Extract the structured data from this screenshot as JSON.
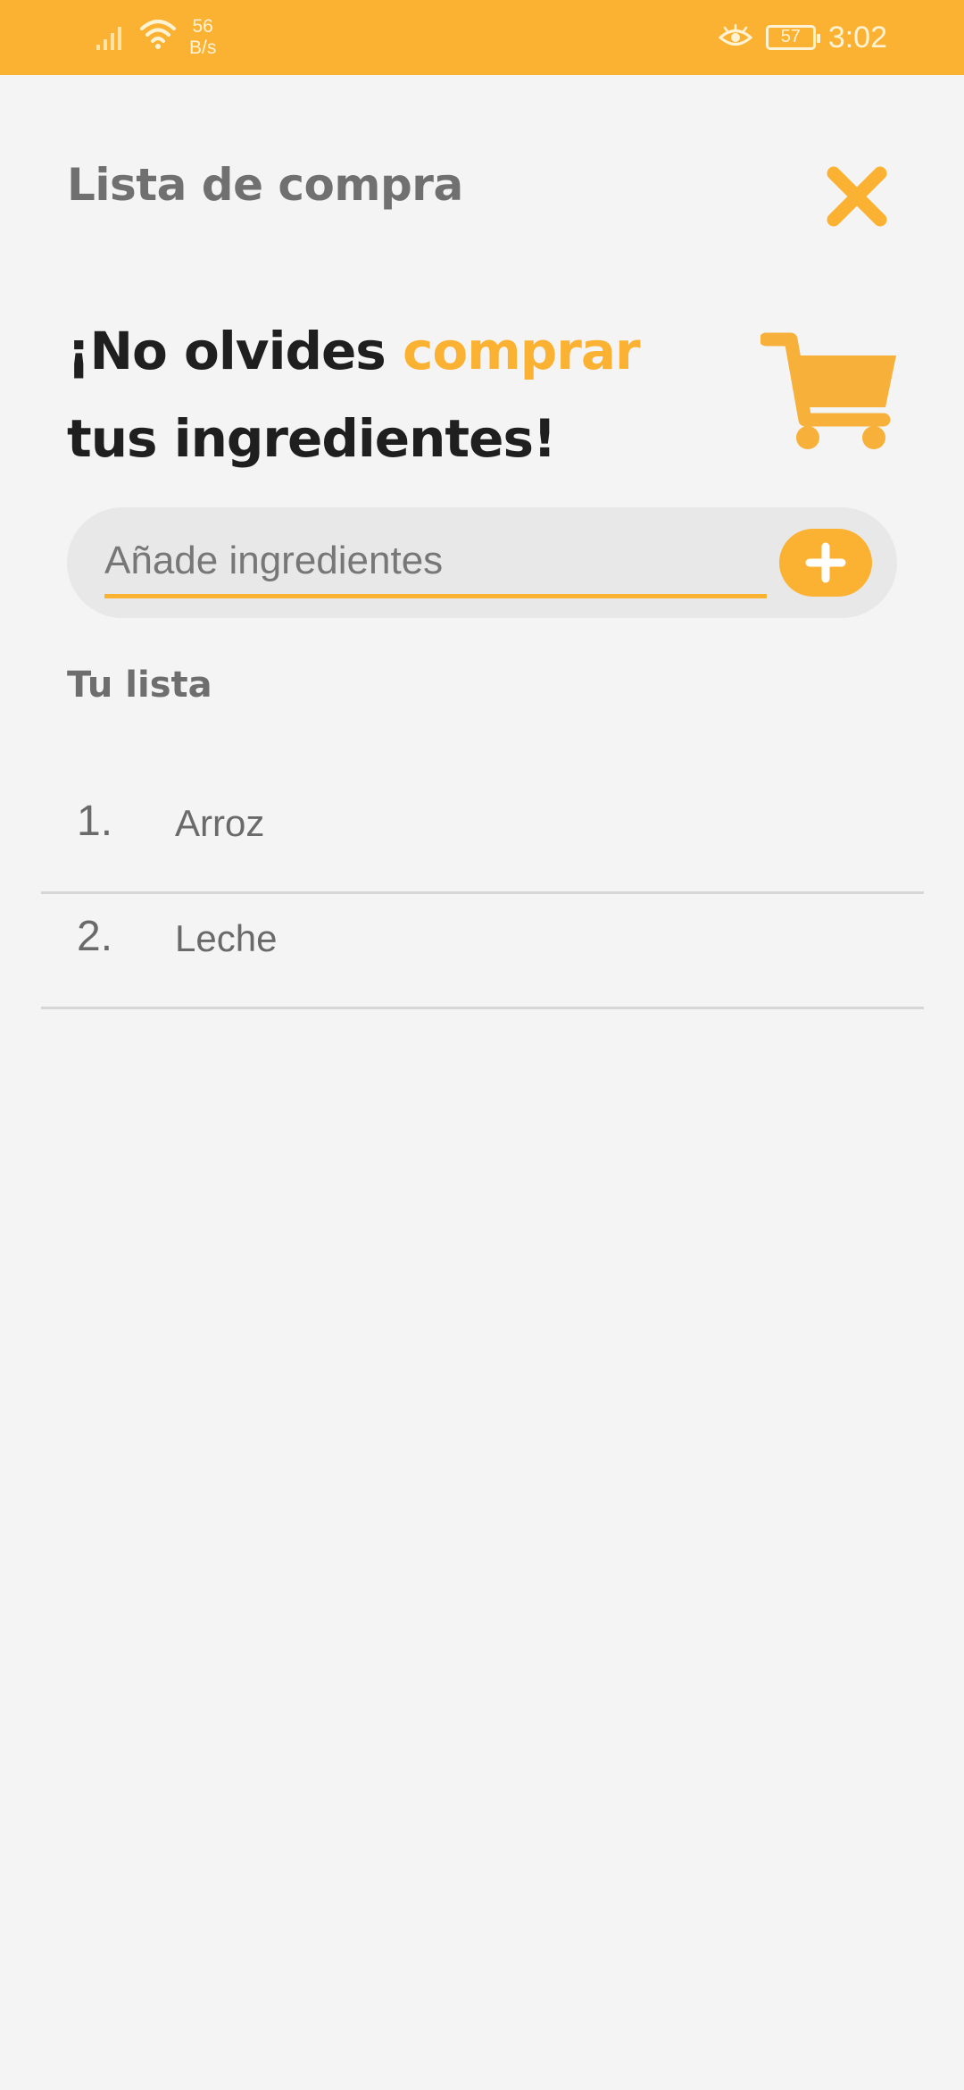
{
  "status_bar": {
    "net_speed_value": "56",
    "net_speed_unit": "B/s",
    "battery_level": "57",
    "time": "3:02",
    "icons": [
      "signal-icon",
      "wifi-icon",
      "eye-comfort-icon",
      "battery-icon"
    ]
  },
  "header": {
    "title": "Lista de compra",
    "close_icon": "close-icon"
  },
  "hero": {
    "line1_before": "¡No olvides ",
    "line1_accent": "comprar",
    "line2": "tus ingredientes!",
    "icon": "shopping-cart-icon"
  },
  "add_bar": {
    "placeholder": "Añade ingredientes",
    "value": "",
    "button_icon": "plus-icon"
  },
  "list": {
    "title": "Tu lista",
    "items": [
      {
        "number": "1.",
        "name": "Arroz"
      },
      {
        "number": "2.",
        "name": "Leche"
      }
    ]
  },
  "colors": {
    "accent": "#fbb232",
    "background": "#f4f4f4",
    "title_gray": "#707070",
    "heading_dark": "#1f1f1f"
  }
}
